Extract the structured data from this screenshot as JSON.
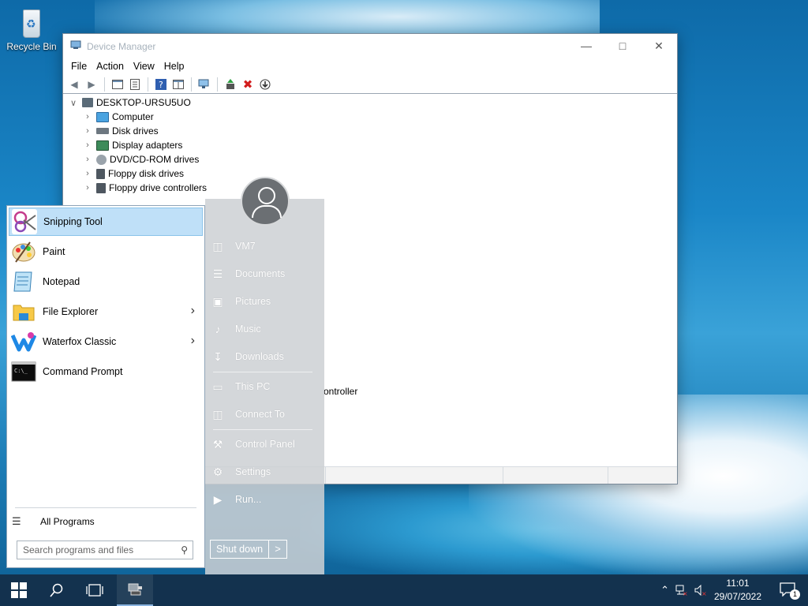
{
  "desktop": {
    "recycle_bin_label": "Recycle Bin"
  },
  "window": {
    "title": "Device Manager",
    "menu": [
      "File",
      "Action",
      "View",
      "Help"
    ],
    "tree_root": "DESKTOP-URSU5UO",
    "tree_items": [
      "Computer",
      "Disk drives",
      "Display adapters",
      "DVD/CD-ROM drives",
      "Floppy disk drives",
      "Floppy drive controllers"
    ],
    "partial_item_text": "ontroller"
  },
  "start_menu": {
    "programs": [
      {
        "label": "Snipping Tool",
        "icon": "scissors-icon",
        "has_arrow": false,
        "selected": true
      },
      {
        "label": "Paint",
        "icon": "paint-palette-icon",
        "has_arrow": false
      },
      {
        "label": "Notepad",
        "icon": "notepad-icon",
        "has_arrow": false
      },
      {
        "label": "File Explorer",
        "icon": "folder-icon",
        "has_arrow": true
      },
      {
        "label": "Waterfox Classic",
        "icon": "waterfox-icon",
        "has_arrow": true
      },
      {
        "label": "Command Prompt",
        "icon": "command-prompt-icon",
        "has_arrow": false
      }
    ],
    "all_programs": "All Programs",
    "search_placeholder": "Search programs and files",
    "right_links": [
      {
        "label": "VM7",
        "icon": "user-folder-icon"
      },
      {
        "label": "Documents",
        "icon": "documents-icon"
      },
      {
        "label": "Pictures",
        "icon": "pictures-icon"
      },
      {
        "label": "Music",
        "icon": "music-icon"
      },
      {
        "label": "Downloads",
        "icon": "downloads-icon"
      },
      {
        "label": "This PC",
        "icon": "computer-icon"
      },
      {
        "label": "Connect To",
        "icon": "network-icon"
      },
      {
        "label": "Control Panel",
        "icon": "control-panel-icon"
      },
      {
        "label": "Settings",
        "icon": "gear-icon"
      },
      {
        "label": "Run...",
        "icon": "run-icon"
      }
    ],
    "shutdown_label": "Shut down",
    "shutdown_arrow": ">"
  },
  "taskbar": {
    "time": "11:01",
    "date": "29/07/2022",
    "notification_count": "1"
  }
}
